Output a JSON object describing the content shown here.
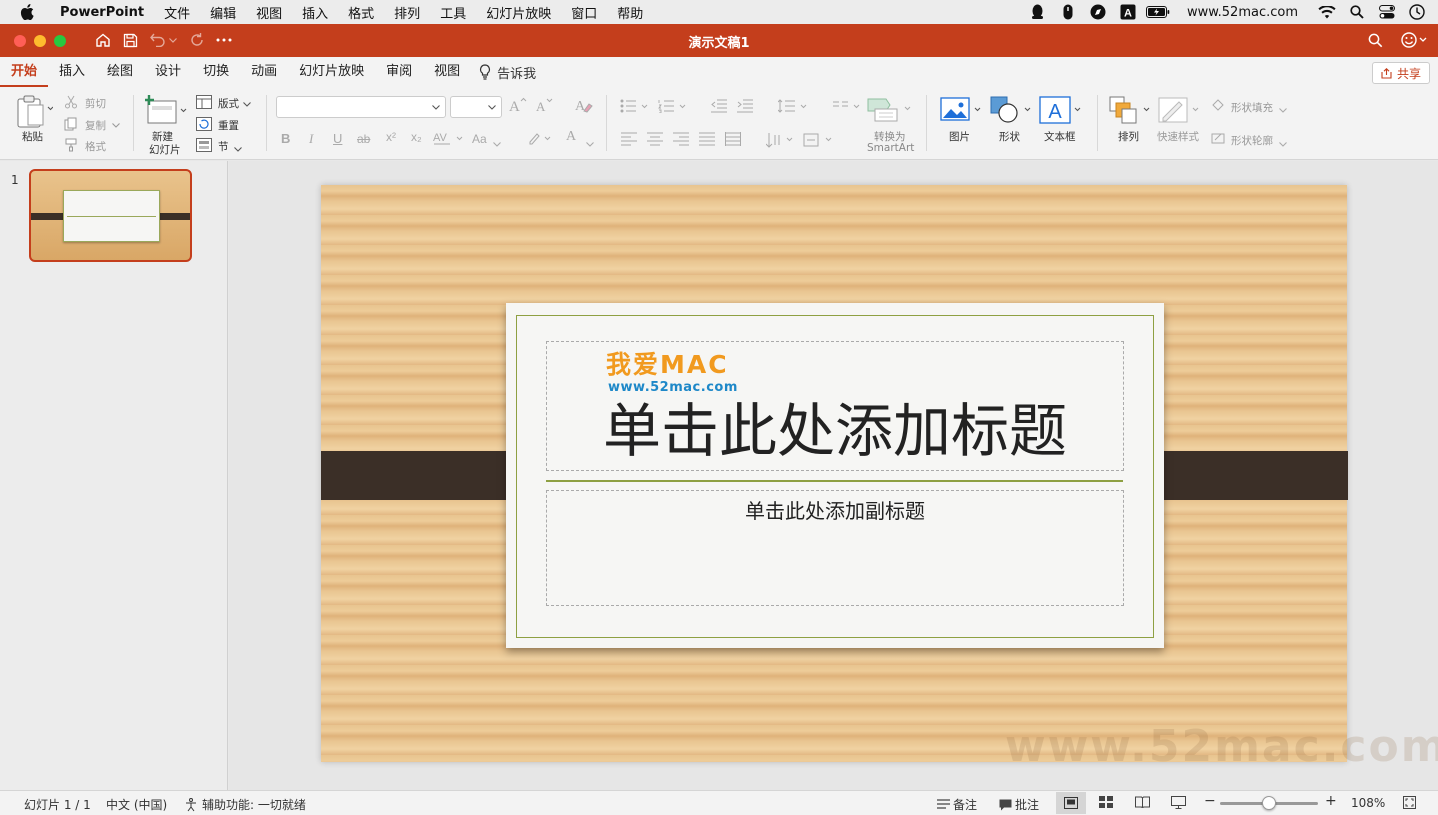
{
  "menubar": {
    "app_name": "PowerPoint",
    "items": [
      "文件",
      "编辑",
      "视图",
      "插入",
      "格式",
      "排列",
      "工具",
      "幻灯片放映",
      "窗口",
      "帮助"
    ],
    "url": "www.52mac.com"
  },
  "window": {
    "title": "演示文稿1",
    "accent_color": "#c43e1c"
  },
  "tabs": {
    "items": [
      "开始",
      "插入",
      "绘图",
      "设计",
      "切换",
      "动画",
      "幻灯片放映",
      "审阅",
      "视图"
    ],
    "tell_me": "告诉我",
    "share": "共享"
  },
  "ribbon": {
    "paste": "粘贴",
    "cut": "剪切",
    "copy": "复制",
    "format": "格式",
    "new_slide_line1": "新建",
    "new_slide_line2": "幻灯片",
    "layout": "版式",
    "reset": "重置",
    "section": "节",
    "convert_line1": "转换为",
    "convert_line2": "SmartArt",
    "picture": "图片",
    "shape": "形状",
    "textbox": "文本框",
    "arrange": "排列",
    "quick_styles": "快速样式",
    "shape_fill": "形状填充",
    "shape_outline": "形状轮廓",
    "text_label": "A",
    "font_change": "Aa"
  },
  "thumbnails": [
    {
      "number": "1"
    }
  ],
  "slide": {
    "logo_text": "我爱MAC",
    "logo_url": "www.52mac.com",
    "title_placeholder": "单击此处添加标题",
    "subtitle_placeholder": "单击此处添加副标题",
    "watermark": "www.52mac.com"
  },
  "status": {
    "slide_info": "幻灯片 1 / 1",
    "language": "中文 (中国)",
    "accessibility": "辅助功能: 一切就绪",
    "notes": "备注",
    "comments": "批注",
    "zoom": "108%"
  }
}
